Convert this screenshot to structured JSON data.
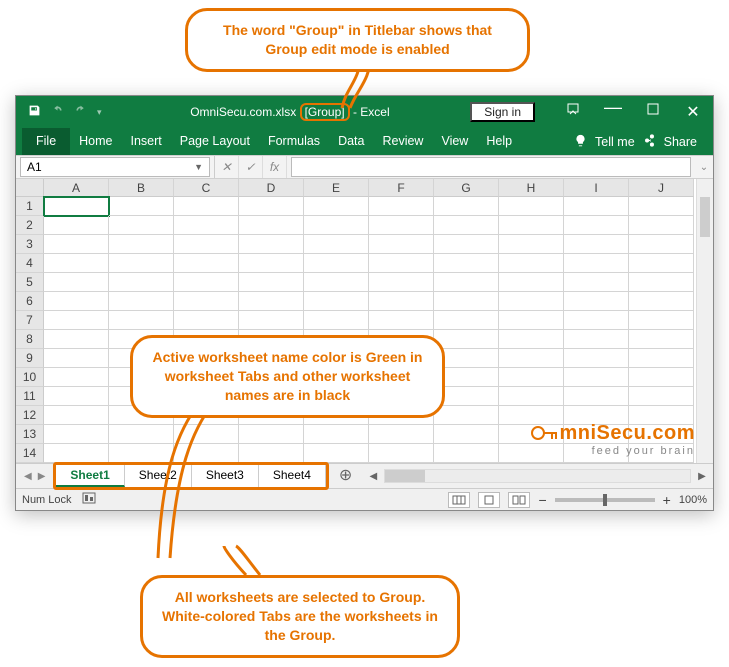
{
  "callouts": {
    "top": "The word \"Group\" in Titlebar shows that Group edit mode is enabled",
    "mid": "Active worksheet name color is Green in worksheet Tabs and other worksheet names are in black",
    "bottom": "All worksheets are selected to Group. White-colored Tabs are the worksheets in the Group."
  },
  "title": {
    "file": "OmniSecu.com.xlsx",
    "group": "[Group]",
    "suffix": "-  Excel",
    "signin": "Sign in"
  },
  "ribbon": {
    "tabs": [
      "File",
      "Home",
      "Insert",
      "Page Layout",
      "Formulas",
      "Data",
      "Review",
      "View",
      "Help"
    ],
    "tell_me": "Tell me",
    "share": "Share"
  },
  "formula_bar": {
    "ref": "A1",
    "fx": "fx"
  },
  "grid": {
    "cols": [
      "A",
      "B",
      "C",
      "D",
      "E",
      "F",
      "G",
      "H",
      "I",
      "J"
    ],
    "rows": [
      "1",
      "2",
      "3",
      "4",
      "5",
      "6",
      "7",
      "8",
      "9",
      "10",
      "11",
      "12",
      "13",
      "14"
    ]
  },
  "sheets": {
    "tabs": [
      "Sheet1",
      "Sheet2",
      "Sheet3",
      "Sheet4"
    ],
    "active_index": 0
  },
  "status": {
    "left": "Num Lock",
    "zoom": "100%"
  },
  "watermark": {
    "main": "mniSecu.com",
    "tag": "feed your brain"
  }
}
